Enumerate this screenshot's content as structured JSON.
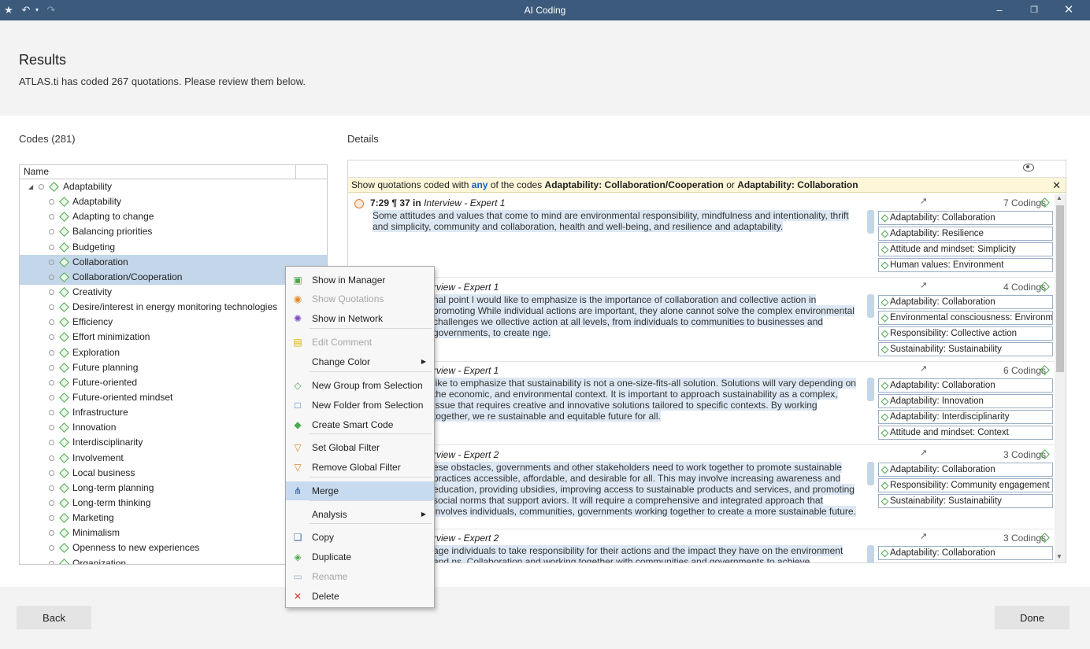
{
  "window": {
    "title": "AI Coding"
  },
  "header": {
    "title": "Results",
    "subtitle": "ATLAS.ti has coded 267 quotations. Please review them below."
  },
  "codes_panel": {
    "label": "Codes (281)",
    "column_name": "Name"
  },
  "tree": {
    "root": "Adaptability",
    "items": [
      "Adaptability",
      "Adapting to change",
      "Balancing priorities",
      "Budgeting",
      "Collaboration",
      "Collaboration/Cooperation",
      "Creativity",
      "Desire/interest in energy monitoring  technologies",
      "Efficiency",
      "Effort minimization",
      "Exploration",
      "Future planning",
      "Future-oriented",
      "Future-oriented mindset",
      "Infrastructure",
      "Innovation",
      "Interdisciplinarity",
      "Involvement",
      "Local business",
      "Long-term planning",
      "Long-term thinking",
      "Marketing",
      "Minimalism",
      "Openness to new experiences",
      "Organization"
    ]
  },
  "details": {
    "label": "Details",
    "filter": {
      "prefix": "Show quotations coded with",
      "any": "any",
      "middle": "of the codes",
      "code1": "Adaptability: Collaboration/Cooperation",
      "or": "or",
      "code2": "Adaptability: Collaboration"
    },
    "quotes": [
      {
        "ref": "7:29 ¶ 37 in",
        "doc": "Interview - Expert 1",
        "text": "Some attitudes and values that come to mind are environmental responsibility, mindfulness and intentionality, thrift and simplicity, community and collaboration, health and well-being, and resilience and adaptability.",
        "codings": "7 Codings",
        "codes": [
          "Adaptability: Collaboration",
          "Adaptability: Resilience",
          "Attitude and mindset: Simplicity",
          "Human values: Environment"
        ]
      },
      {
        "ref": "",
        "doc": "rview - Expert 1",
        "text": "nal point I would like to emphasize is the importance of collaboration and collective action in promoting While individual actions are important, they alone cannot solve the complex environmental challenges we ollective action at all levels, from individuals to communities to businesses and governments, to create nge.",
        "codings": "4 Codings",
        "codes": [
          "Adaptability: Collaboration",
          "Environmental consciousness: Environm...",
          "Responsibility: Collective action",
          "Sustainability: Sustainability"
        ]
      },
      {
        "ref": "",
        "doc": "rview - Expert 1",
        "text": "like to emphasize that sustainability is not a one-size-fits-all solution. Solutions will vary depending on the economic, and environmental context. It is important to approach sustainability as a complex, issue that requires creative and innovative solutions tailored to specific contexts. By working together, we re sustainable and equitable future for all.",
        "codings": "6 Codings",
        "codes": [
          "Adaptability: Collaboration",
          "Adaptability: Innovation",
          "Adaptability: Interdisciplinarity",
          "Attitude and mindset: Context"
        ]
      },
      {
        "ref": "",
        "doc": "rview - Expert 2",
        "text": "ese obstacles, governments and other stakeholders need to work together to promote sustainable practices accessible, affordable, and desirable for all. This may involve increasing awareness and education, providing ubsidies, improving access to sustainable products and services, and promoting social norms that support aviors. It will require a comprehensive and integrated approach that involves individuals, communities, governments working together to create a more sustainable future.",
        "codings": "3 Codings",
        "codes": [
          "Adaptability: Collaboration",
          "Responsibility: Community engagement",
          "Sustainability: Sustainability"
        ]
      },
      {
        "ref": "",
        "doc": "rview - Expert 2",
        "text": "age individuals to take responsibility for their actions and the impact they have on the environment and ns. Collaboration and working together with communities and governments to achieve sustainability goals",
        "codings": "3 Codings",
        "codes": [
          "Adaptability: Collaboration"
        ]
      }
    ]
  },
  "context_menu": {
    "items": [
      {
        "label": "Show in Manager",
        "icon": "manager-icon",
        "disabled": false
      },
      {
        "label": "Show Quotations",
        "icon": "quotations-icon",
        "disabled": true
      },
      {
        "label": "Show in Network",
        "icon": "network-icon",
        "disabled": false
      },
      {
        "label": "Edit Comment",
        "icon": "comment-icon",
        "disabled": true
      },
      {
        "label": "Change Color",
        "icon": "",
        "disabled": false,
        "submenu": true
      },
      {
        "label": "New Group from Selection",
        "icon": "group-icon",
        "disabled": false
      },
      {
        "label": "New Folder from Selection",
        "icon": "folder-icon",
        "disabled": false
      },
      {
        "label": "Create Smart Code",
        "icon": "smart-code-icon",
        "disabled": false
      },
      {
        "label": "Set Global Filter",
        "icon": "filter-icon",
        "disabled": false
      },
      {
        "label": "Remove Global Filter",
        "icon": "remove-filter-icon",
        "disabled": false
      },
      {
        "label": "Merge",
        "icon": "merge-icon",
        "disabled": false,
        "highlighted": true
      },
      {
        "label": "Analysis",
        "icon": "",
        "disabled": false,
        "submenu": true
      },
      {
        "label": "Copy",
        "icon": "copy-icon",
        "disabled": false
      },
      {
        "label": "Duplicate",
        "icon": "duplicate-icon",
        "disabled": false
      },
      {
        "label": "Rename",
        "icon": "rename-icon",
        "disabled": true
      },
      {
        "label": "Delete",
        "icon": "delete-icon",
        "disabled": false
      }
    ]
  },
  "footer": {
    "back": "Back",
    "done": "Done"
  },
  "colors": {
    "titlebar": "#3c5a7c",
    "selection": "#c3d6ea",
    "code_green": "#4caa4c",
    "filter_bg": "#fdf6d8"
  }
}
